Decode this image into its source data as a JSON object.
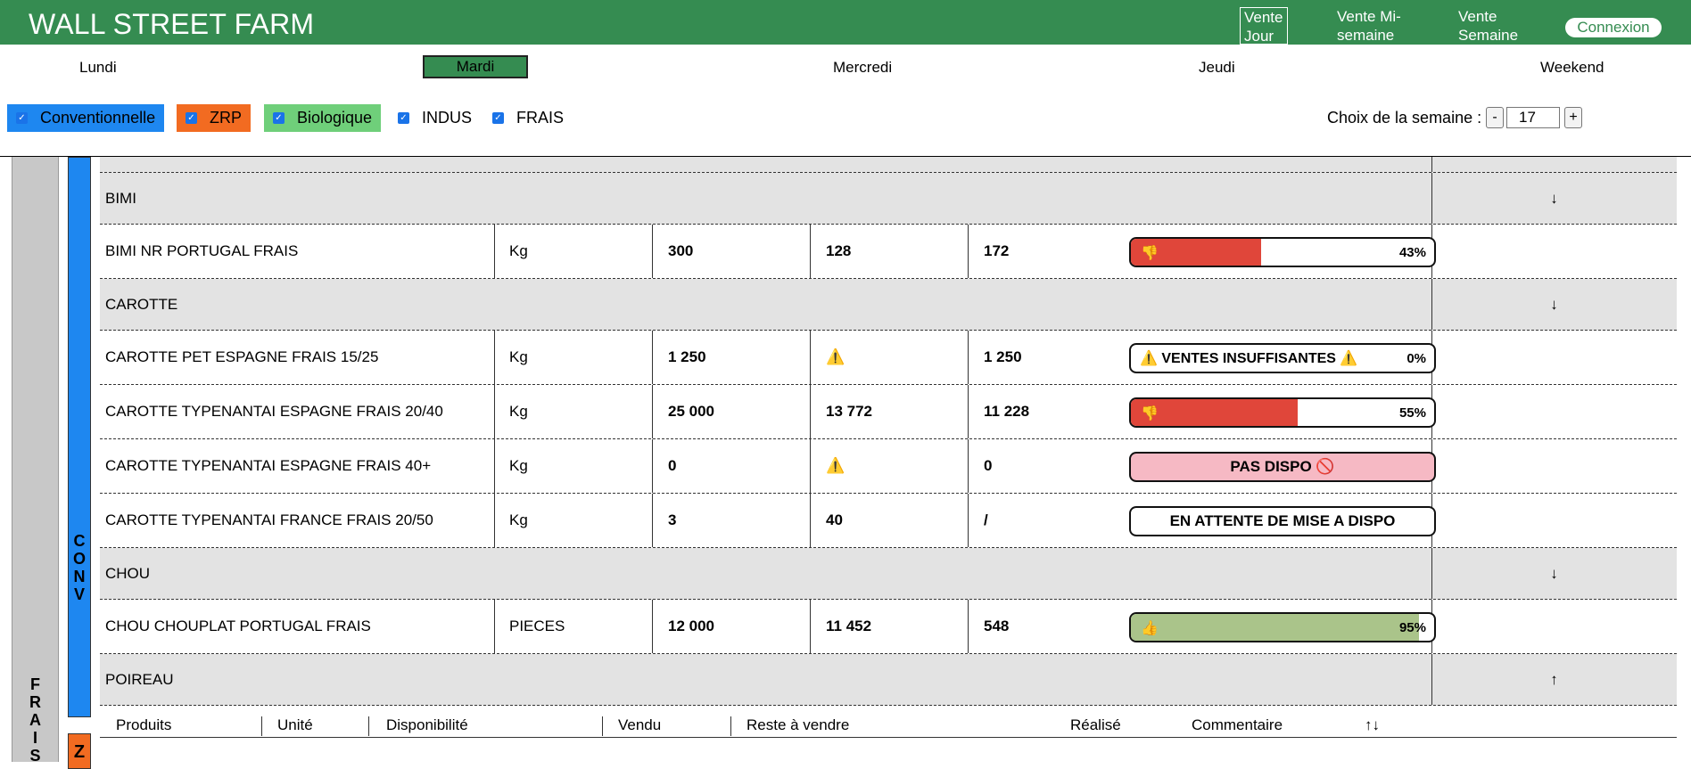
{
  "header": {
    "title": "WALL STREET FARM",
    "nav": [
      {
        "label_1": "Vente",
        "label_2": "Jour",
        "active": true
      },
      {
        "label_1": "Vente Mi-",
        "label_2": "semaine",
        "active": false
      },
      {
        "label_1": "Vente",
        "label_2": "Semaine",
        "active": false
      }
    ],
    "connexion": "Connexion"
  },
  "days": [
    "Lundi",
    "Mardi",
    "Mercredi",
    "Jeudi",
    "Weekend"
  ],
  "active_day": "Mardi",
  "filters": [
    {
      "label": "Conventionnelle",
      "checked": true,
      "color": "#1e87f0"
    },
    {
      "label": "ZRP",
      "checked": true,
      "color": "#f26b21"
    },
    {
      "label": "Biologique",
      "checked": true,
      "color": "#6fcf7a"
    },
    {
      "label": "INDUS",
      "checked": true,
      "color": ""
    },
    {
      "label": "FRAIS",
      "checked": true,
      "color": ""
    }
  ],
  "week": {
    "label": "Choix de la semaine :",
    "minus": "-",
    "value": "17",
    "plus": "+"
  },
  "side": {
    "frais": "FRAIS",
    "conv": "CONV",
    "zrp": "Z"
  },
  "colors": {
    "brand_green": "#358c51",
    "bad_red": "#e0463a",
    "good_green": "#aac48a",
    "pink": "#f6b9c4"
  },
  "rows": [
    {
      "kind": "group",
      "name": "BIMI",
      "arrow": "↓"
    },
    {
      "kind": "item",
      "name": "BIMI NR PORTUGAL FRAIS",
      "unit": "Kg",
      "dispo": "300",
      "vendu": "128",
      "reste": "172",
      "status": "bar",
      "icon": "👎",
      "pct": "43%",
      "ratio": 0.43,
      "fill": "#e0463a"
    },
    {
      "kind": "group",
      "name": "CAROTTE",
      "arrow": "↓"
    },
    {
      "kind": "item",
      "name": "CAROTTE PET ESPAGNE FRAIS 15/25",
      "unit": "Kg",
      "dispo": "1 250",
      "vendu": "⚠️",
      "reste": "1 250",
      "status": "text",
      "text": "⚠️ VENTES INSUFFISANTES ⚠️",
      "pct": "0%"
    },
    {
      "kind": "item",
      "name": "CAROTTE TYPENANTAI ESPAGNE FRAIS 20/40",
      "unit": "Kg",
      "dispo": "25 000",
      "vendu": "13 772",
      "reste": "11 228",
      "status": "bar",
      "icon": "👎",
      "pct": "55%",
      "ratio": 0.55,
      "fill": "#e0463a"
    },
    {
      "kind": "item",
      "name": "CAROTTE TYPENANTAI ESPAGNE FRAIS 40+",
      "unit": "Kg",
      "dispo": "0",
      "vendu": "⚠️",
      "reste": "0",
      "status": "pink",
      "text": "PAS DISPO 🚫"
    },
    {
      "kind": "item",
      "name": "CAROTTE TYPENANTAI FRANCE FRAIS 20/50",
      "unit": "Kg",
      "dispo": "3",
      "vendu": "40",
      "reste": "/",
      "status": "plain",
      "text": "EN ATTENTE DE MISE A DISPO"
    },
    {
      "kind": "group",
      "name": "CHOU",
      "arrow": "↓"
    },
    {
      "kind": "item",
      "name": "CHOU CHOUPLAT PORTUGAL FRAIS",
      "unit": "PIECES",
      "dispo": "12 000",
      "vendu": "11 452",
      "reste": "548",
      "status": "bar",
      "icon": "👍",
      "pct": "95%",
      "ratio": 0.95,
      "fill": "#aac48a"
    },
    {
      "kind": "group",
      "name": "POIREAU",
      "arrow": "↑"
    }
  ],
  "footer": {
    "produits": "Produits",
    "unite": "Unité",
    "dispo": "Disponibilité",
    "vendu": "Vendu",
    "reste": "Reste à vendre",
    "realise": "Réalisé",
    "commentaire": "Commentaire",
    "sort": "↑↓"
  }
}
